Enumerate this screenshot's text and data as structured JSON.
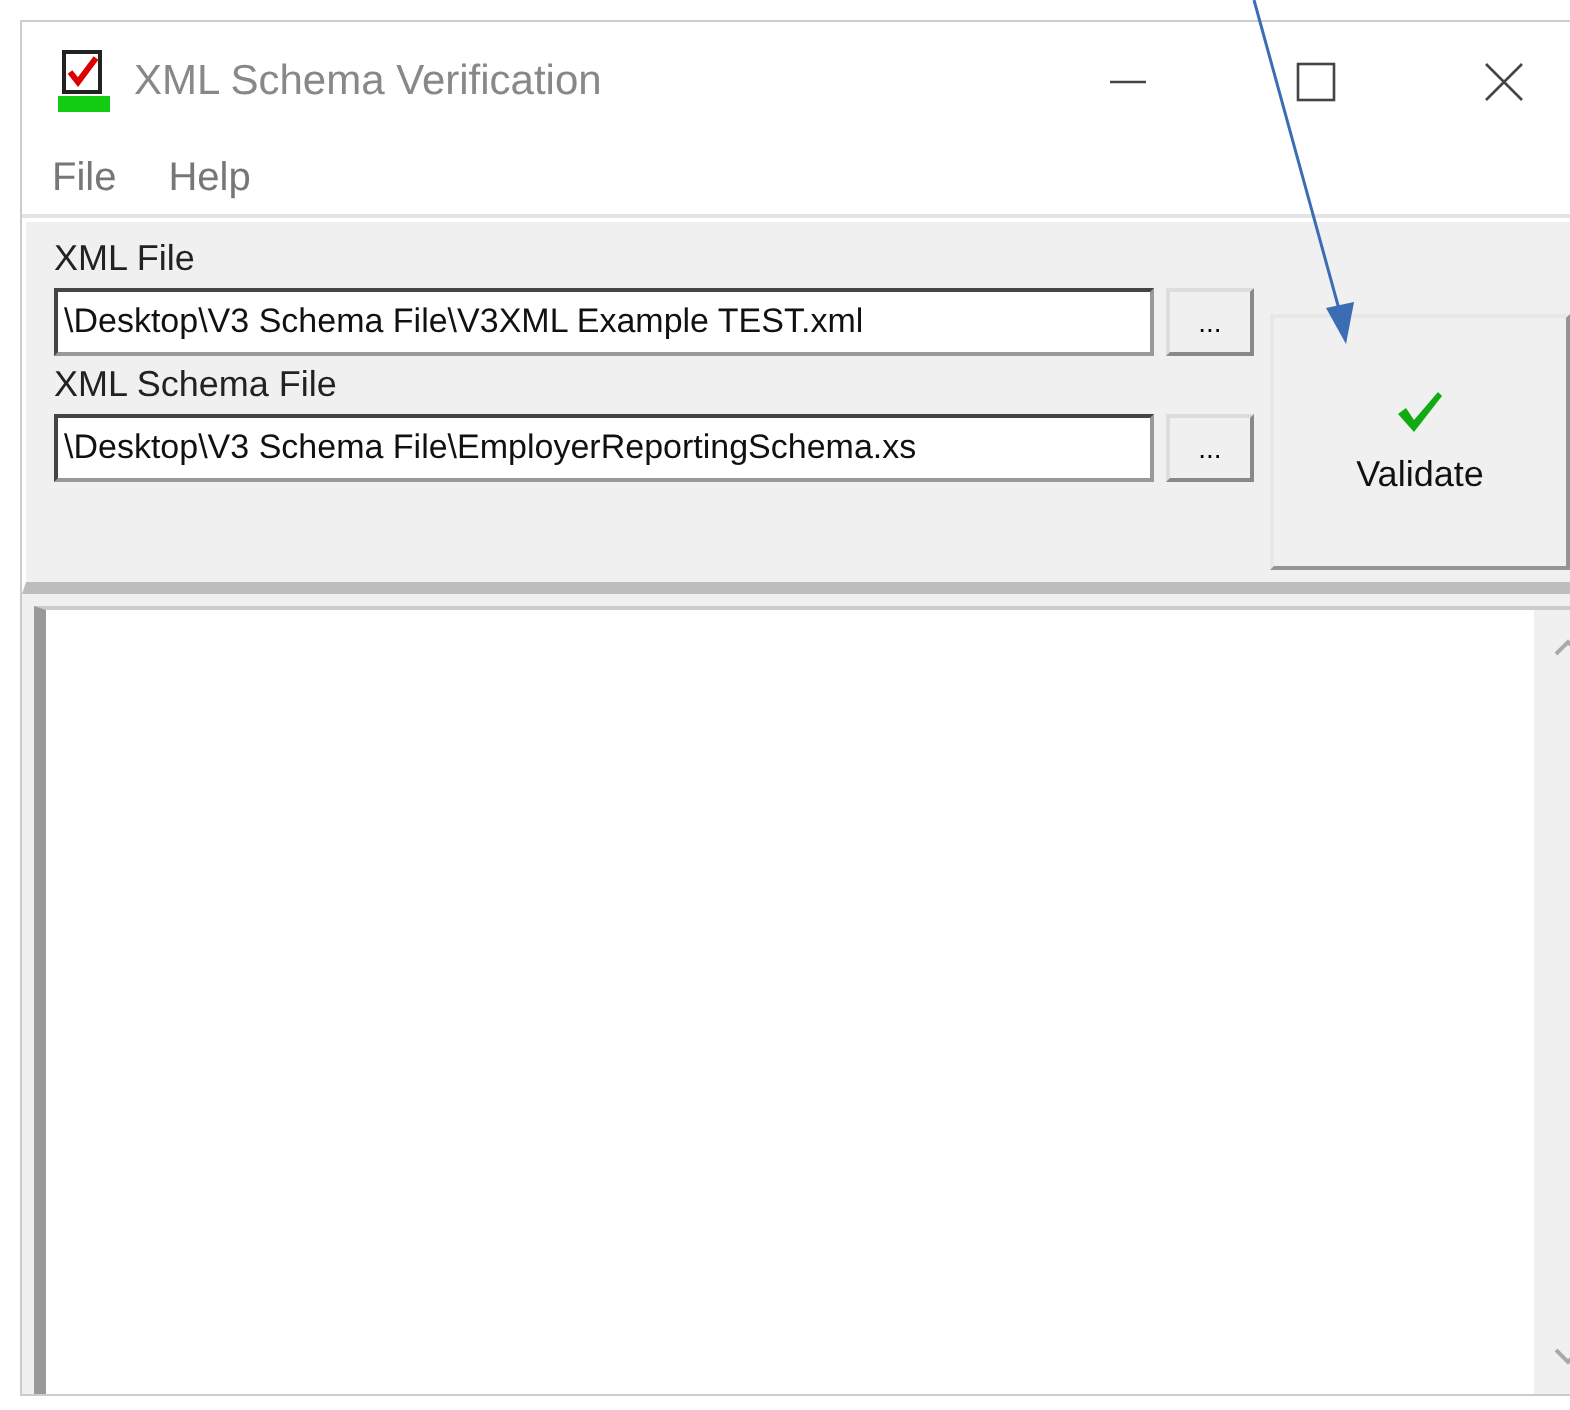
{
  "window": {
    "title": "XML Schema Verification"
  },
  "menu": [
    "File",
    "Help"
  ],
  "xml_file": {
    "label": "XML File",
    "value": "\\Desktop\\V3 Schema File\\V3XML Example TEST.xml",
    "browse": "..."
  },
  "schema_file": {
    "label": "XML Schema File",
    "value": "\\Desktop\\V3 Schema File\\EmployerReportingSchema.xs",
    "browse": "..."
  },
  "validate_button": {
    "label": "Validate"
  }
}
